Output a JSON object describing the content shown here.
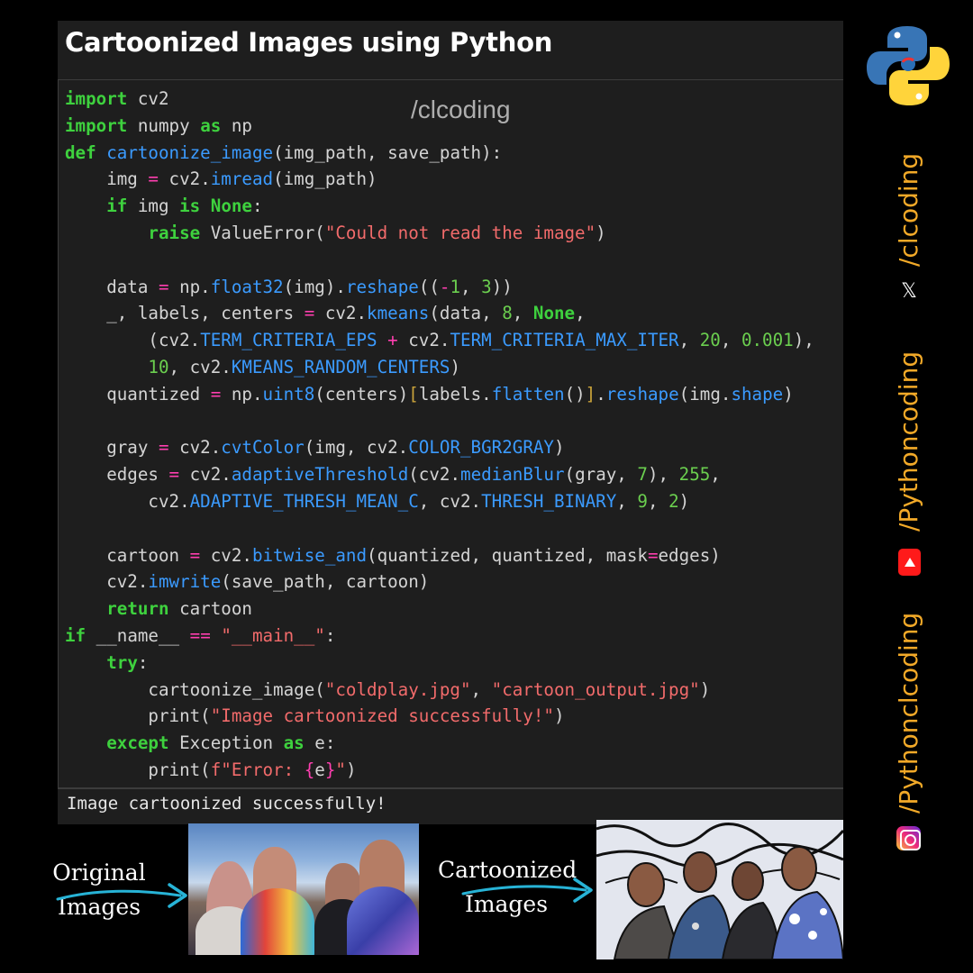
{
  "title": "Cartoonized Images using Python",
  "watermark": "/clcoding",
  "output_text": "Image cartoonized successfully!",
  "social": {
    "handle_x": "/clcoding",
    "handle_youtube": "/Pythoncoding",
    "handle_instagram": "/Pythonclcoding",
    "x_glyph": "𝕏"
  },
  "captions": {
    "original_line1": "Original",
    "original_line2": "Images",
    "cartoon_line1": "Cartoonized",
    "cartoon_line2": "Images"
  },
  "colors": {
    "accent": "#f2a928",
    "keyword": "#3ed13e",
    "function": "#3b9bff",
    "string": "#f26b6b",
    "number": "#6bcf4f",
    "operator": "#ff3fb0",
    "background": "#1e1e1e"
  },
  "icons": [
    "python-logo-icon",
    "x-icon",
    "youtube-icon",
    "instagram-icon",
    "arrow-icon"
  ],
  "code_lines": [
    [
      [
        "kw",
        "import"
      ],
      [
        "t",
        " cv2"
      ]
    ],
    [
      [
        "kw",
        "import"
      ],
      [
        "t",
        " numpy "
      ],
      [
        "kw",
        "as"
      ],
      [
        "t",
        " np"
      ]
    ],
    [
      [
        "kw",
        "def"
      ],
      [
        "t",
        " "
      ],
      [
        "fn",
        "cartoonize_image"
      ],
      [
        "t",
        "(img_path, save_path):"
      ]
    ],
    [
      [
        "t",
        "    img "
      ],
      [
        "op",
        "="
      ],
      [
        "t",
        " cv2."
      ],
      [
        "fn",
        "imread"
      ],
      [
        "t",
        "(img_path)"
      ]
    ],
    [
      [
        "t",
        "    "
      ],
      [
        "kw",
        "if"
      ],
      [
        "t",
        " img "
      ],
      [
        "kw",
        "is"
      ],
      [
        "t",
        " "
      ],
      [
        "kw",
        "None"
      ],
      [
        "t",
        ":"
      ]
    ],
    [
      [
        "t",
        "        "
      ],
      [
        "kw",
        "raise"
      ],
      [
        "t",
        " ValueError("
      ],
      [
        "str",
        "\"Could not read the image\""
      ],
      [
        "t",
        ")"
      ]
    ],
    [
      [
        "t",
        ""
      ]
    ],
    [
      [
        "t",
        "    data "
      ],
      [
        "op",
        "="
      ],
      [
        "t",
        " np."
      ],
      [
        "fn",
        "float32"
      ],
      [
        "t",
        "(img)."
      ],
      [
        "fn",
        "reshape"
      ],
      [
        "t",
        "(("
      ],
      [
        "op",
        "-"
      ],
      [
        "num",
        "1"
      ],
      [
        "t",
        ", "
      ],
      [
        "num",
        "3"
      ],
      [
        "t",
        "))"
      ]
    ],
    [
      [
        "t",
        "    _, labels, centers "
      ],
      [
        "op",
        "="
      ],
      [
        "t",
        " cv2."
      ],
      [
        "fn",
        "kmeans"
      ],
      [
        "t",
        "(data, "
      ],
      [
        "num",
        "8"
      ],
      [
        "t",
        ", "
      ],
      [
        "kw",
        "None"
      ],
      [
        "t",
        ","
      ]
    ],
    [
      [
        "t",
        "        (cv2."
      ],
      [
        "fn",
        "TERM_CRITERIA_EPS"
      ],
      [
        "t",
        " "
      ],
      [
        "op",
        "+"
      ],
      [
        "t",
        " cv2."
      ],
      [
        "fn",
        "TERM_CRITERIA_MAX_ITER"
      ],
      [
        "t",
        ", "
      ],
      [
        "num",
        "20"
      ],
      [
        "t",
        ", "
      ],
      [
        "num",
        "0.001"
      ],
      [
        "t",
        "),"
      ]
    ],
    [
      [
        "t",
        "        "
      ],
      [
        "num",
        "10"
      ],
      [
        "t",
        ", cv2."
      ],
      [
        "fn",
        "KMEANS_RANDOM_CENTERS"
      ],
      [
        "t",
        ")"
      ]
    ],
    [
      [
        "t",
        "    quantized "
      ],
      [
        "op",
        "="
      ],
      [
        "t",
        " np."
      ],
      [
        "fn",
        "uint8"
      ],
      [
        "t",
        "(centers)"
      ],
      [
        "br",
        "["
      ],
      [
        "t",
        "labels."
      ],
      [
        "fn",
        "flatten"
      ],
      [
        "t",
        "()"
      ],
      [
        "br",
        "]"
      ],
      [
        "t",
        "."
      ],
      [
        "fn",
        "reshape"
      ],
      [
        "t",
        "(img."
      ],
      [
        "fn",
        "shape"
      ],
      [
        "t",
        ")"
      ]
    ],
    [
      [
        "t",
        ""
      ]
    ],
    [
      [
        "t",
        "    gray "
      ],
      [
        "op",
        "="
      ],
      [
        "t",
        " cv2."
      ],
      [
        "fn",
        "cvtColor"
      ],
      [
        "t",
        "(img, cv2."
      ],
      [
        "fn",
        "COLOR_BGR2GRAY"
      ],
      [
        "t",
        ")"
      ]
    ],
    [
      [
        "t",
        "    edges "
      ],
      [
        "op",
        "="
      ],
      [
        "t",
        " cv2."
      ],
      [
        "fn",
        "adaptiveThreshold"
      ],
      [
        "t",
        "(cv2."
      ],
      [
        "fn",
        "medianBlur"
      ],
      [
        "t",
        "(gray, "
      ],
      [
        "num",
        "7"
      ],
      [
        "t",
        "), "
      ],
      [
        "num",
        "255"
      ],
      [
        "t",
        ","
      ]
    ],
    [
      [
        "t",
        "        cv2."
      ],
      [
        "fn",
        "ADAPTIVE_THRESH_MEAN_C"
      ],
      [
        "t",
        ", cv2."
      ],
      [
        "fn",
        "THRESH_BINARY"
      ],
      [
        "t",
        ", "
      ],
      [
        "num",
        "9"
      ],
      [
        "t",
        ", "
      ],
      [
        "num",
        "2"
      ],
      [
        "t",
        ")"
      ]
    ],
    [
      [
        "t",
        ""
      ]
    ],
    [
      [
        "t",
        "    cartoon "
      ],
      [
        "op",
        "="
      ],
      [
        "t",
        " cv2."
      ],
      [
        "fn",
        "bitwise_and"
      ],
      [
        "t",
        "(quantized, quantized, mask"
      ],
      [
        "op",
        "="
      ],
      [
        "t",
        "edges)"
      ]
    ],
    [
      [
        "t",
        "    cv2."
      ],
      [
        "fn",
        "imwrite"
      ],
      [
        "t",
        "(save_path, cartoon)"
      ]
    ],
    [
      [
        "t",
        "    "
      ],
      [
        "kw",
        "return"
      ],
      [
        "t",
        " cartoon"
      ]
    ],
    [
      [
        "kw",
        "if"
      ],
      [
        "t",
        " __name__ "
      ],
      [
        "op",
        "=="
      ],
      [
        "t",
        " "
      ],
      [
        "str",
        "\"__main__\""
      ],
      [
        "t",
        ":"
      ]
    ],
    [
      [
        "t",
        "    "
      ],
      [
        "kw",
        "try"
      ],
      [
        "t",
        ":"
      ]
    ],
    [
      [
        "t",
        "        cartoonize_image("
      ],
      [
        "str",
        "\"coldplay.jpg\""
      ],
      [
        "t",
        ", "
      ],
      [
        "str",
        "\"cartoon_output.jpg\""
      ],
      [
        "t",
        ")"
      ]
    ],
    [
      [
        "t",
        "        print("
      ],
      [
        "str",
        "\"Image cartoonized successfully!\""
      ],
      [
        "t",
        ")"
      ]
    ],
    [
      [
        "t",
        "    "
      ],
      [
        "kw",
        "except"
      ],
      [
        "t",
        " Exception "
      ],
      [
        "kw",
        "as"
      ],
      [
        "t",
        " e:"
      ]
    ],
    [
      [
        "t",
        "        print("
      ],
      [
        "str",
        "f\"Error: "
      ],
      [
        "op",
        "{"
      ],
      [
        "t",
        "e"
      ],
      [
        "op",
        "}"
      ],
      [
        "str",
        "\""
      ],
      [
        "t",
        ")"
      ]
    ]
  ]
}
